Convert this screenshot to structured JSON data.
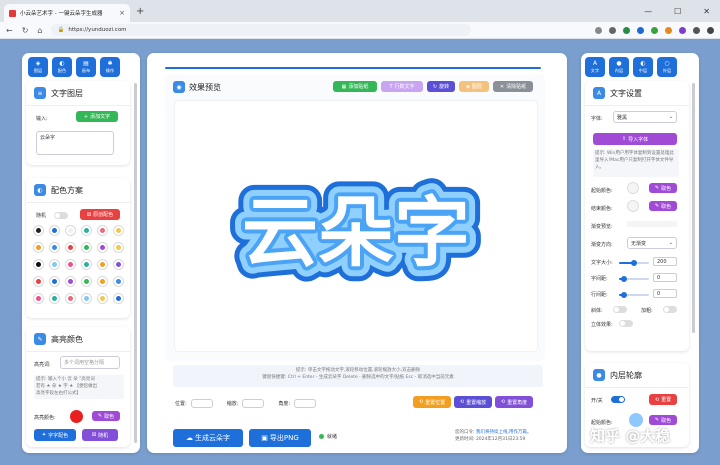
{
  "browser": {
    "tab_title": "小云朵艺术字 - 一键云朵字生成器",
    "url": "https://yunduozi.com",
    "colors": {
      "chrome": "#dee3ea",
      "page_bg": "#7a9fce",
      "accent": "#1e6fd9"
    }
  },
  "left_nav": [
    {
      "icon": "layers-icon",
      "label": "图层"
    },
    {
      "icon": "palette-icon",
      "label": "配色"
    },
    {
      "icon": "brush-icon",
      "label": "画布"
    },
    {
      "icon": "gear-icon",
      "label": "操作"
    }
  ],
  "text_layer": {
    "title": "文字图层",
    "input_label": "输入:",
    "add_button": "添加文字",
    "text_value": "云朵字"
  },
  "color_scheme": {
    "title": "配色方案",
    "random_label": "随机",
    "random_button": "原创配色"
  },
  "highlight": {
    "title": "高亮颜色",
    "keyword_label": "高亮词:",
    "keyword_placeholder": "多个词用空格分隔",
    "tip_line1": "提示: 输入个小 云 朵 \"高亮词",
    "tip_line2": "若有 ★ 朵 ★ 字 ★ 【便您做出",
    "tip_line3": "高亮字段左右打公式】",
    "color_label": "高亮颜色:",
    "pick_button": "取色",
    "color": "#e82020",
    "smart_button": "字字配色",
    "random_button": "随机"
  },
  "preview": {
    "title": "效果预览",
    "toolbar": [
      {
        "label": "添加贴纸",
        "color": "#34b857"
      },
      {
        "label": "行数文字",
        "color": "#c9a4f2"
      },
      {
        "label": "旋转",
        "color": "#5b4fd6"
      },
      {
        "label": "图层",
        "color": "#f4c27d"
      },
      {
        "label": "清除贴纸",
        "color": "#8a8f98"
      }
    ],
    "cloud_text": "云朵字",
    "tip1": "提示: 单击文字拖动文字,滚轮移动位置,滚轮缩放大小,双击删除",
    "tip2": "键盘快捷键: Ctrl + Enter - 生成云朵字 Delete - 删除选中的文字/贴纸 Esc - 取消选中当前元素",
    "pos_label": "位置:",
    "scale_label": "缩放:",
    "angle_label": "角度:",
    "reset_pos": "重置位置",
    "reset_scale": "重置缩放",
    "reset_angle": "重置角度"
  },
  "actions": {
    "generate": "生成云朵字",
    "export": "导出PNG",
    "status": "就绪",
    "footer_line1a": "您的口令: ",
    "footer_line1b": "我们将持续上线,用作万篇。",
    "footer_line2": "更新时间: 2024年12月31日23:59"
  },
  "right_nav": [
    {
      "icon": "text-icon",
      "label": "文字"
    },
    {
      "icon": "inner-icon",
      "label": "内层"
    },
    {
      "icon": "middle-icon",
      "label": "中层"
    },
    {
      "icon": "outer-icon",
      "label": "外层"
    }
  ],
  "text_settings": {
    "title": "文字设置",
    "font_label": "字体:",
    "font_value": "雅黑",
    "import_button": "导入字体",
    "tip": "提示: Win用户用字体复制到设置处理此里导入!Mac用户只复制打开字体文件导入。",
    "start_color_label": "起始颜色:",
    "end_color_label": "结束颜色:",
    "pick_button": "取色",
    "gradient_preview_label": "渐变预览:",
    "gradient_dir_label": "渐变方向:",
    "gradient_dir_value": "无渐变",
    "font_size_label": "文字大小:",
    "font_size_value": "200",
    "letter_spacing_label": "字间距:",
    "letter_spacing_value": "0",
    "line_spacing_label": "行间距:",
    "line_spacing_value": "0",
    "italic_label": "斜体:",
    "bold_label": "加粗:",
    "stereo_label": "立体效果:"
  },
  "inner_outline": {
    "title": "内层轮廓",
    "toggle_label": "开/关",
    "reset_button": "重置",
    "start_color_label": "起始颜色:",
    "pick_button": "取色"
  },
  "watermark": "知乎 @大稳"
}
